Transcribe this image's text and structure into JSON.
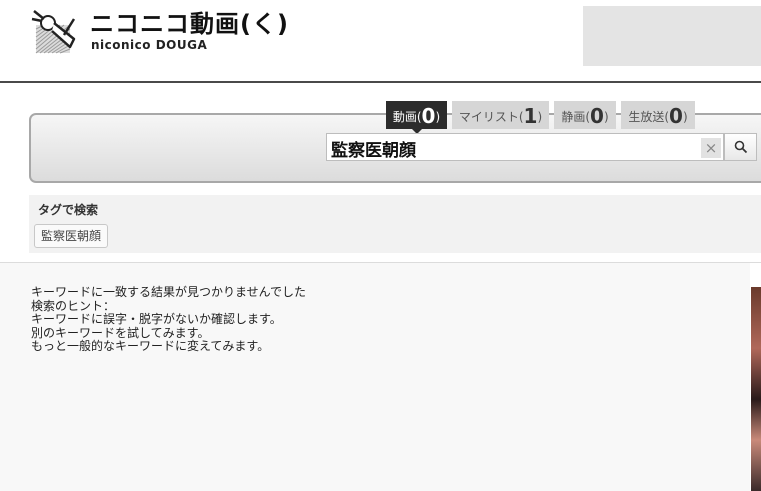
{
  "header": {
    "logo_main": "ニコニコ動画(く)",
    "logo_sub": "niconico DOUGA"
  },
  "search": {
    "tabs": [
      {
        "label": "動画(",
        "count": "0",
        "close": ")"
      },
      {
        "label": "マイリスト(",
        "count": "1",
        "close": ")"
      },
      {
        "label": "静画(",
        "count": "0",
        "close": ")"
      },
      {
        "label": "生放送(",
        "count": "0",
        "close": ")"
      }
    ],
    "query": "監察医朝顔",
    "clear_label": "×"
  },
  "tag_search": {
    "heading": "タグで検索",
    "tags": [
      "監察医朝顔"
    ]
  },
  "results": {
    "lines": [
      "キーワードに一致する結果が見つかりませんでした",
      "検索のヒント：",
      "キーワードに誤字・脱字がないか確認します。",
      "別のキーワードを試してみます。",
      "もっと一般的なキーワードに変えてみます。"
    ]
  }
}
